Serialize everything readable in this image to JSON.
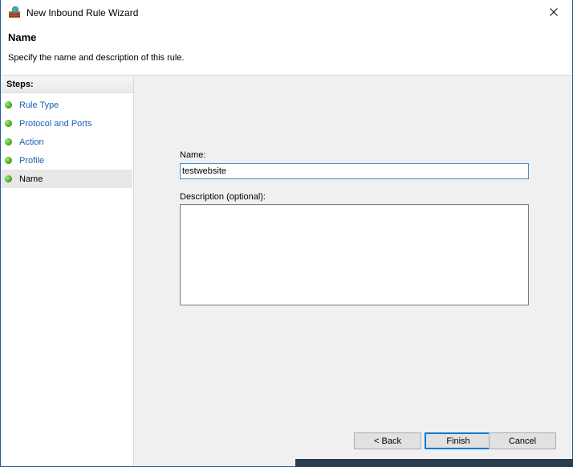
{
  "window": {
    "title": "New Inbound Rule Wizard",
    "close_symbol": "✕"
  },
  "header": {
    "title": "Name",
    "description": "Specify the name and description of this rule."
  },
  "steps": {
    "heading": "Steps:",
    "items": [
      {
        "label": "Rule Type"
      },
      {
        "label": "Protocol and Ports"
      },
      {
        "label": "Action"
      },
      {
        "label": "Profile"
      },
      {
        "label": "Name"
      }
    ]
  },
  "form": {
    "name_label": "Name:",
    "name_value": "testwebsite",
    "description_label": "Description (optional):",
    "description_value": ""
  },
  "buttons": {
    "back": "< Back",
    "finish": "Finish",
    "cancel": "Cancel"
  },
  "colors": {
    "accent": "#0078d7",
    "step_link": "#1a5fb4",
    "step_dot": "#4caf23"
  },
  "icons": {
    "app": "firewall-icon",
    "close": "close-icon",
    "step": "green-dot-icon"
  }
}
